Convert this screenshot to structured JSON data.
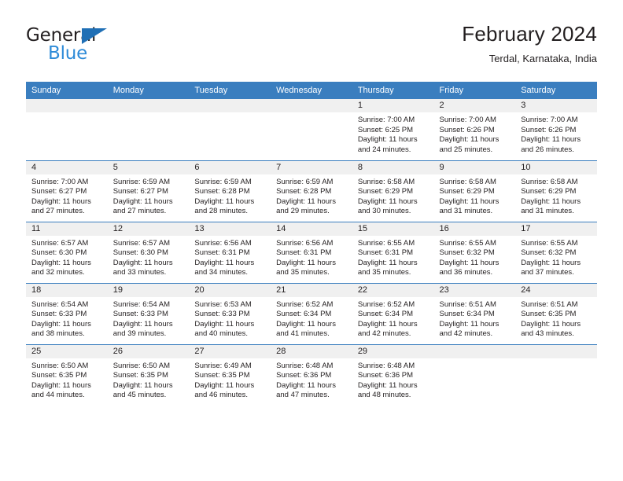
{
  "brand": {
    "name_top": "General",
    "name_bottom": "Blue",
    "accent_color": "#2e8bd8",
    "triangle_color": "#1f6fb5"
  },
  "header": {
    "title": "February 2024",
    "subtitle": "Terdal, Karnataka, India"
  },
  "calendar": {
    "header_bg": "#3a7ebf",
    "daynum_bg": "#f0f0f0",
    "weekday_headers": [
      "Sunday",
      "Monday",
      "Tuesday",
      "Wednesday",
      "Thursday",
      "Friday",
      "Saturday"
    ],
    "weeks": [
      [
        {
          "day": "",
          "lines": []
        },
        {
          "day": "",
          "lines": []
        },
        {
          "day": "",
          "lines": []
        },
        {
          "day": "",
          "lines": []
        },
        {
          "day": "1",
          "lines": [
            "Sunrise: 7:00 AM",
            "Sunset: 6:25 PM",
            "Daylight: 11 hours",
            "and 24 minutes."
          ]
        },
        {
          "day": "2",
          "lines": [
            "Sunrise: 7:00 AM",
            "Sunset: 6:26 PM",
            "Daylight: 11 hours",
            "and 25 minutes."
          ]
        },
        {
          "day": "3",
          "lines": [
            "Sunrise: 7:00 AM",
            "Sunset: 6:26 PM",
            "Daylight: 11 hours",
            "and 26 minutes."
          ]
        }
      ],
      [
        {
          "day": "4",
          "lines": [
            "Sunrise: 7:00 AM",
            "Sunset: 6:27 PM",
            "Daylight: 11 hours",
            "and 27 minutes."
          ]
        },
        {
          "day": "5",
          "lines": [
            "Sunrise: 6:59 AM",
            "Sunset: 6:27 PM",
            "Daylight: 11 hours",
            "and 27 minutes."
          ]
        },
        {
          "day": "6",
          "lines": [
            "Sunrise: 6:59 AM",
            "Sunset: 6:28 PM",
            "Daylight: 11 hours",
            "and 28 minutes."
          ]
        },
        {
          "day": "7",
          "lines": [
            "Sunrise: 6:59 AM",
            "Sunset: 6:28 PM",
            "Daylight: 11 hours",
            "and 29 minutes."
          ]
        },
        {
          "day": "8",
          "lines": [
            "Sunrise: 6:58 AM",
            "Sunset: 6:29 PM",
            "Daylight: 11 hours",
            "and 30 minutes."
          ]
        },
        {
          "day": "9",
          "lines": [
            "Sunrise: 6:58 AM",
            "Sunset: 6:29 PM",
            "Daylight: 11 hours",
            "and 31 minutes."
          ]
        },
        {
          "day": "10",
          "lines": [
            "Sunrise: 6:58 AM",
            "Sunset: 6:29 PM",
            "Daylight: 11 hours",
            "and 31 minutes."
          ]
        }
      ],
      [
        {
          "day": "11",
          "lines": [
            "Sunrise: 6:57 AM",
            "Sunset: 6:30 PM",
            "Daylight: 11 hours",
            "and 32 minutes."
          ]
        },
        {
          "day": "12",
          "lines": [
            "Sunrise: 6:57 AM",
            "Sunset: 6:30 PM",
            "Daylight: 11 hours",
            "and 33 minutes."
          ]
        },
        {
          "day": "13",
          "lines": [
            "Sunrise: 6:56 AM",
            "Sunset: 6:31 PM",
            "Daylight: 11 hours",
            "and 34 minutes."
          ]
        },
        {
          "day": "14",
          "lines": [
            "Sunrise: 6:56 AM",
            "Sunset: 6:31 PM",
            "Daylight: 11 hours",
            "and 35 minutes."
          ]
        },
        {
          "day": "15",
          "lines": [
            "Sunrise: 6:55 AM",
            "Sunset: 6:31 PM",
            "Daylight: 11 hours",
            "and 35 minutes."
          ]
        },
        {
          "day": "16",
          "lines": [
            "Sunrise: 6:55 AM",
            "Sunset: 6:32 PM",
            "Daylight: 11 hours",
            "and 36 minutes."
          ]
        },
        {
          "day": "17",
          "lines": [
            "Sunrise: 6:55 AM",
            "Sunset: 6:32 PM",
            "Daylight: 11 hours",
            "and 37 minutes."
          ]
        }
      ],
      [
        {
          "day": "18",
          "lines": [
            "Sunrise: 6:54 AM",
            "Sunset: 6:33 PM",
            "Daylight: 11 hours",
            "and 38 minutes."
          ]
        },
        {
          "day": "19",
          "lines": [
            "Sunrise: 6:54 AM",
            "Sunset: 6:33 PM",
            "Daylight: 11 hours",
            "and 39 minutes."
          ]
        },
        {
          "day": "20",
          "lines": [
            "Sunrise: 6:53 AM",
            "Sunset: 6:33 PM",
            "Daylight: 11 hours",
            "and 40 minutes."
          ]
        },
        {
          "day": "21",
          "lines": [
            "Sunrise: 6:52 AM",
            "Sunset: 6:34 PM",
            "Daylight: 11 hours",
            "and 41 minutes."
          ]
        },
        {
          "day": "22",
          "lines": [
            "Sunrise: 6:52 AM",
            "Sunset: 6:34 PM",
            "Daylight: 11 hours",
            "and 42 minutes."
          ]
        },
        {
          "day": "23",
          "lines": [
            "Sunrise: 6:51 AM",
            "Sunset: 6:34 PM",
            "Daylight: 11 hours",
            "and 42 minutes."
          ]
        },
        {
          "day": "24",
          "lines": [
            "Sunrise: 6:51 AM",
            "Sunset: 6:35 PM",
            "Daylight: 11 hours",
            "and 43 minutes."
          ]
        }
      ],
      [
        {
          "day": "25",
          "lines": [
            "Sunrise: 6:50 AM",
            "Sunset: 6:35 PM",
            "Daylight: 11 hours",
            "and 44 minutes."
          ]
        },
        {
          "day": "26",
          "lines": [
            "Sunrise: 6:50 AM",
            "Sunset: 6:35 PM",
            "Daylight: 11 hours",
            "and 45 minutes."
          ]
        },
        {
          "day": "27",
          "lines": [
            "Sunrise: 6:49 AM",
            "Sunset: 6:35 PM",
            "Daylight: 11 hours",
            "and 46 minutes."
          ]
        },
        {
          "day": "28",
          "lines": [
            "Sunrise: 6:48 AM",
            "Sunset: 6:36 PM",
            "Daylight: 11 hours",
            "and 47 minutes."
          ]
        },
        {
          "day": "29",
          "lines": [
            "Sunrise: 6:48 AM",
            "Sunset: 6:36 PM",
            "Daylight: 11 hours",
            "and 48 minutes."
          ]
        },
        {
          "day": "",
          "lines": []
        },
        {
          "day": "",
          "lines": []
        }
      ]
    ]
  }
}
